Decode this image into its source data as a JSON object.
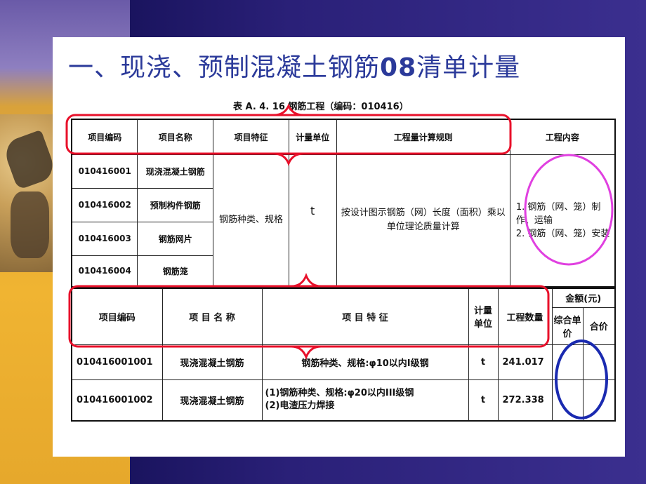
{
  "title_prefix": "一、现浇、预制混凝土钢筋",
  "title_bold": "08",
  "title_suffix": "清单计量",
  "caption": "表 A. 4. 16  钢筋工程（编码：010416）",
  "table1": {
    "headers": [
      "项目编码",
      "项目名称",
      "项目特征",
      "计量单位",
      "工程量计算规则",
      "工程内容"
    ],
    "rows": [
      {
        "code": "010416001",
        "name": "现浇混凝土钢筋"
      },
      {
        "code": "010416002",
        "name": "预制构件钢筋"
      },
      {
        "code": "010416003",
        "name": "钢筋网片"
      },
      {
        "code": "010416004",
        "name": "钢筋笼"
      }
    ],
    "feature": "钢筋种类、规格",
    "unit": "t",
    "rule": "按设计图示钢筋（网）长度（面积）乘以单位理论质量计算",
    "content": [
      "1. 钢筋（网、笼）制作、运输",
      "2. 钢筋（网、笼）安装"
    ]
  },
  "table2": {
    "headers": {
      "code": "项目编码",
      "name": "项 目 名 称",
      "feature": "项 目 特 征",
      "unit": "计量单位",
      "qty": "工程数量",
      "amount": "金额(元)",
      "unit_price": "综合单价",
      "total": "合价"
    },
    "rows": [
      {
        "code": "010416001001",
        "name": "现浇混凝土钢筋",
        "feature": "钢筋种类、规格:φ10以内Ⅰ级钢",
        "unit": "t",
        "qty": "241.017"
      },
      {
        "code": "010416001002",
        "name": "现浇混凝土钢筋",
        "feature_line1": "(1)钢筋种类、规格:φ20以内III级钢",
        "feature_line2": "(2)电渣压力焊接",
        "unit": "t",
        "qty": "272.338"
      }
    ]
  },
  "colors": {
    "bracket": "#e8102a",
    "circle_magenta": "#e040e0",
    "circle_blue": "#1a2ab0",
    "title": "#2b3a9a"
  }
}
